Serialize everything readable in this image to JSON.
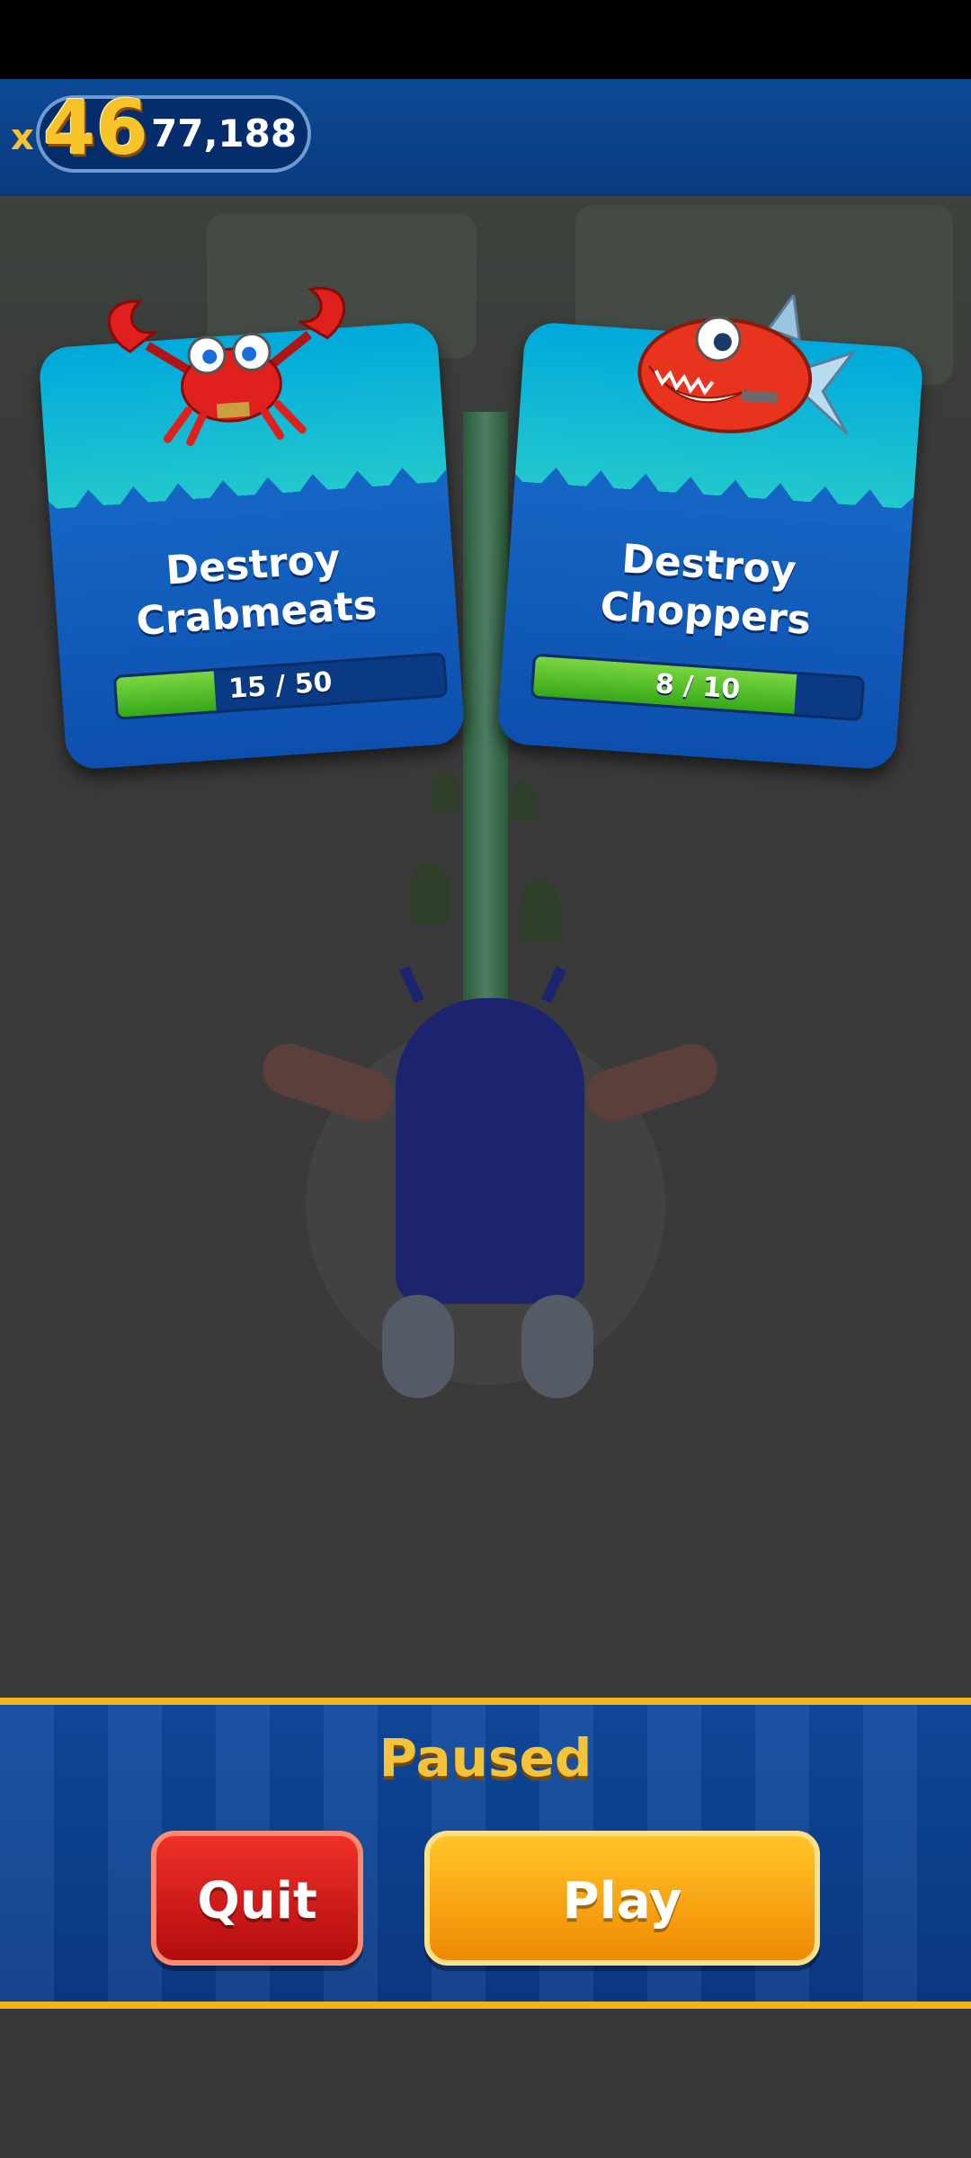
{
  "hud": {
    "multiplier_prefix": "x",
    "multiplier": "46",
    "score": "77,188"
  },
  "missions": [
    {
      "title_line1": "Destroy",
      "title_line2": "Crabmeats",
      "progress_text": "15 / 50",
      "progress": 0.3,
      "enemy": "crabmeat-icon"
    },
    {
      "title_line1": "Destroy",
      "title_line2": "Choppers",
      "progress_text": "8 / 10",
      "progress": 0.8,
      "enemy": "chopper-fish-icon"
    }
  ],
  "pause_panel": {
    "title": "Paused",
    "quit_label": "Quit",
    "play_label": "Play"
  },
  "colors": {
    "gold": "#f5c33a",
    "panel_blue": "#0f4a9e",
    "quit_red": "#d81a16",
    "play_orange": "#f9a614",
    "progress_green": "#5cc22e"
  }
}
